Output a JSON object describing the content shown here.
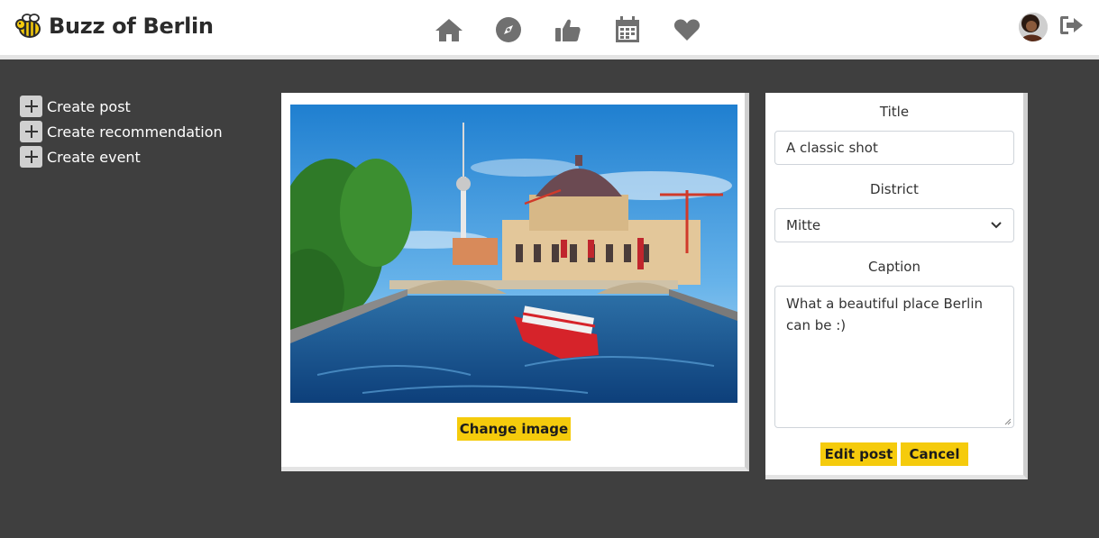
{
  "navbar": {
    "brand": "Buzz of Berlin",
    "brand_icon": "bee-icon",
    "icons": [
      "home-icon",
      "compass-icon",
      "thumbs-up-icon",
      "calendar-icon",
      "heart-icon"
    ],
    "right_icons": [
      "avatar",
      "logout-icon"
    ]
  },
  "sidebar": {
    "items": [
      {
        "label": "Create post",
        "icon": "plus-icon"
      },
      {
        "label": "Create recommendation",
        "icon": "plus-icon"
      },
      {
        "label": "Create event",
        "icon": "plus-icon"
      }
    ]
  },
  "image_card": {
    "change_button": "Change image"
  },
  "form": {
    "title_label": "Title",
    "title_value": "A classic shot",
    "district_label": "District",
    "district_value": "Mitte",
    "caption_label": "Caption",
    "caption_value": "What a beautiful place Berlin can be :)",
    "edit_button": "Edit post",
    "cancel_button": "Cancel"
  },
  "colors": {
    "accent": "#f5cb0c",
    "background": "#3f3f3f",
    "icon": "#707070"
  }
}
